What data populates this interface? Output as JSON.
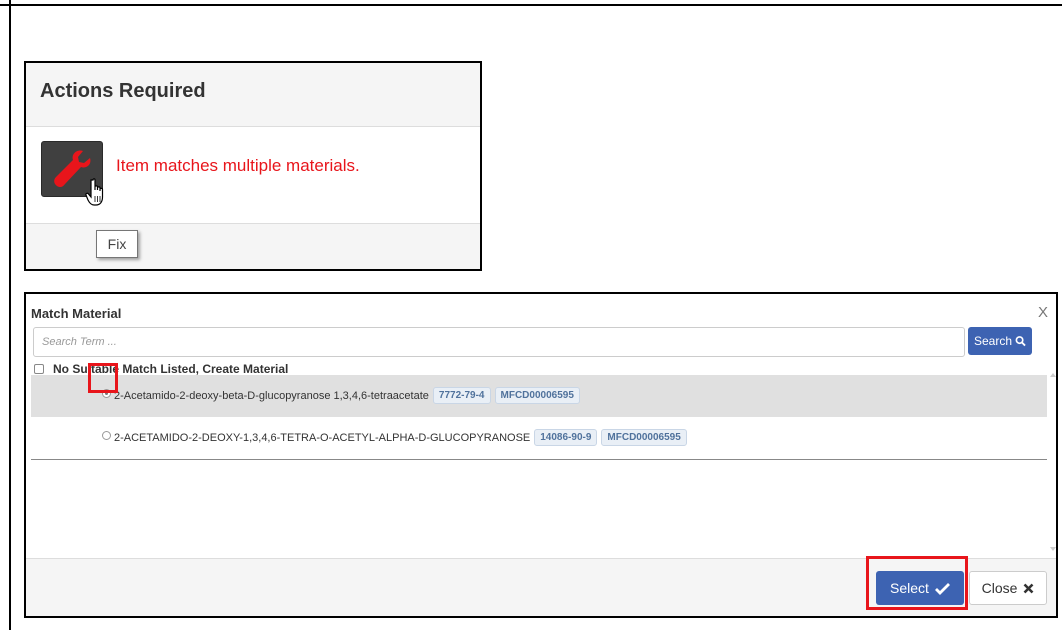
{
  "actions_required": {
    "title": "Actions Required",
    "issue_text": "Item matches multiple materials.",
    "fix_tooltip": "Fix",
    "icons": {
      "fix": "wrench-icon",
      "cursor": "hand-pointer-icon"
    },
    "colors": {
      "issue_text": "#e8151b",
      "fix_icon": "#e8151b",
      "fix_button_bg": "#404040"
    }
  },
  "match_material": {
    "title": "Match Material",
    "close_glyph": "X",
    "search": {
      "placeholder": "Search Term ...",
      "value": "",
      "button_label": "Search",
      "button_icon": "search-icon"
    },
    "no_match_label": "No Suitable Match Listed, Create Material",
    "no_match_checked": false,
    "results": [
      {
        "name": "2-Acetamido-2-deoxy-beta-D-glucopyranose 1,3,4,6-tetraacetate",
        "cas": "7772-79-4",
        "mfcd": "MFCD00006595",
        "selected": true
      },
      {
        "name": "2-ACETAMIDO-2-DEOXY-1,3,4,6-TETRA-O-ACETYL-ALPHA-D-GLUCOPYRANOSE",
        "cas": "14086-90-9",
        "mfcd": "MFCD00006595",
        "selected": false
      }
    ],
    "footer": {
      "select_label": "Select",
      "select_icon": "checkmark-icon",
      "close_label": "Close",
      "close_icon": "close-x-icon"
    },
    "colors": {
      "primary_button": "#3d63b2",
      "highlight": "#e8151b",
      "tag_text": "#50729c"
    }
  }
}
